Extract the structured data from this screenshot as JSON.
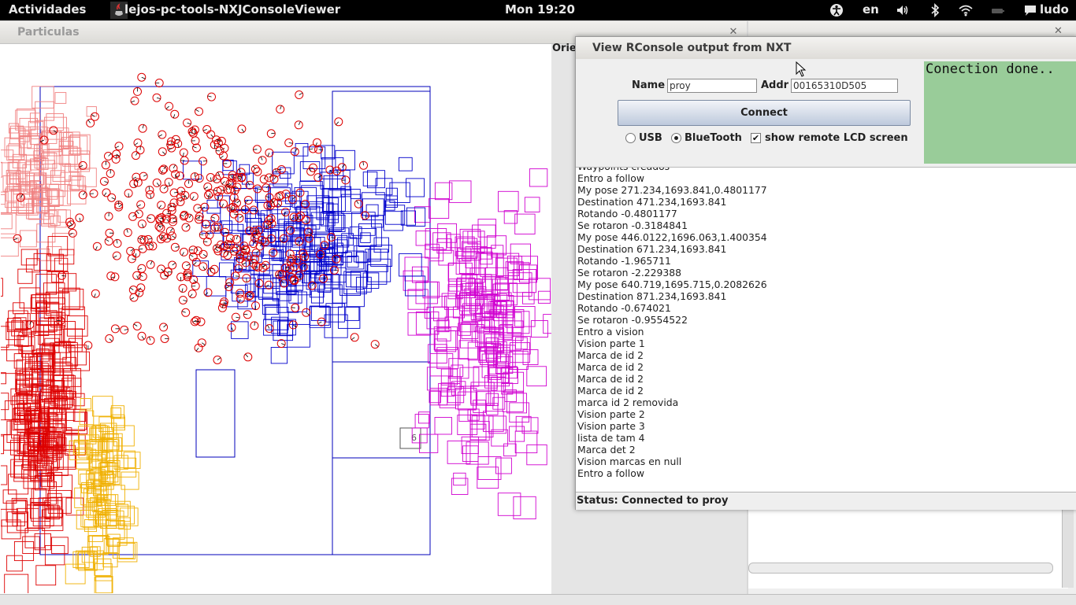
{
  "topbar": {
    "activities": "Actividades",
    "app_name": "lejos-pc-tools-NXJConsoleViewer",
    "clock": "Mon 19:20",
    "language": "en",
    "user": "ludo",
    "icons": [
      "accessibility-icon",
      "volume-icon",
      "bluetooth-icon",
      "wifi-icon",
      "battery-icon",
      "chat-icon"
    ]
  },
  "particles_window": {
    "title": "Particulas",
    "orientation_label": "Orie",
    "landmark_label": "6"
  },
  "rconsole": {
    "title": "View RConsole output from NXT",
    "name_label": "Name",
    "name_value": "proy",
    "addr_label": "Addr",
    "addr_value": "00165310D505",
    "connect_label": "Connect",
    "usb_label": "USB",
    "bluetooth_label": "BlueTooth",
    "lcd_label": "show remote LCD screen",
    "connection_type": "BlueTooth",
    "show_lcd": true,
    "lcd_text": "Conection done..",
    "console_lines": [
      "Waypoints creados",
      "Entro a follow",
      "My pose 271.234,1693.841,0.4801177",
      "Destination 471.234,1693.841",
      "Rotando -0.4801177",
      "Se rotaron -0.3184841",
      "My pose 446.0122,1696.063,1.400354",
      "Destination 671.234,1693.841",
      "Rotando -1.965711",
      "Se rotaron -2.229388",
      "My pose 640.719,1695.715,0.2082626",
      "Destination 871.234,1693.841",
      "Rotando -0.674021",
      "Se rotaron -0.9554522",
      "Entro a vision",
      "Vision parte 1",
      "Marca de id 2",
      "Marca de id 2",
      "Marca de id 2",
      "Marca de id 2",
      "marca id 2 removida",
      "Vision parte 2",
      "Vision parte 3",
      "lista de tam 4",
      "Marca det 2",
      "Vision marcas en null",
      "Entro a follow"
    ],
    "status": "Status: Connected to proy"
  },
  "colors": {
    "red_particles": "#dd0000",
    "pink_particles": "#f08080",
    "blue_particles": "#0000cc",
    "magenta_particles": "#d000d0",
    "yellow_particles": "#f0b000",
    "lcd_background": "#99cc99"
  }
}
